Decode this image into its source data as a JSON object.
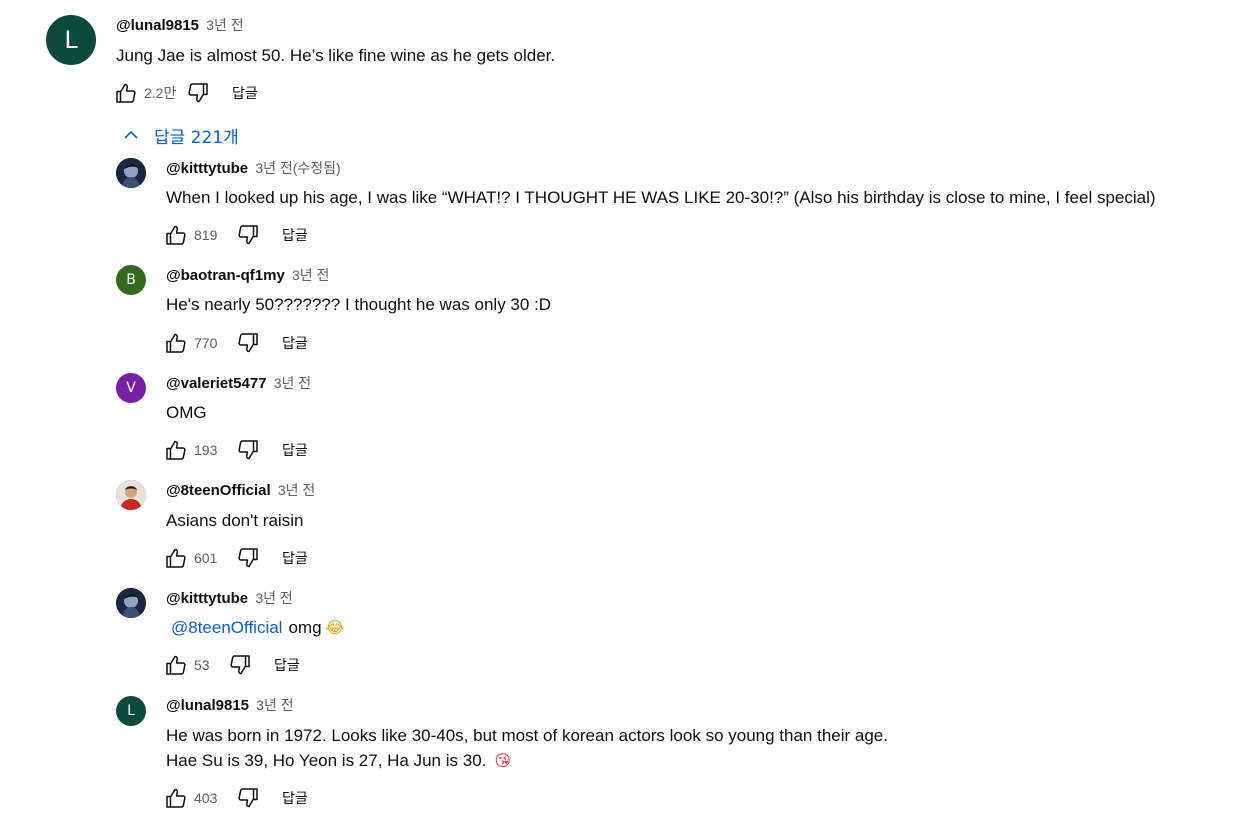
{
  "top_comment": {
    "avatar_letter": "L",
    "avatar_color": "#0d4a3e",
    "handle": "@lunal9815",
    "time": "3년 전",
    "text": "Jung Jae is almost 50. He’s like fine wine as he gets older.",
    "likes": "2.2만",
    "reply_label": "답글",
    "like_icon": "thumbs-up-icon",
    "dislike_icon": "thumbs-down-icon"
  },
  "replies_toggle": {
    "label": "답글 221개",
    "icon": "chevron-up-icon"
  },
  "replies": [
    {
      "handle": "@kitttytube",
      "time": "3년 전(수정됨)",
      "text": "When I looked up his age, I was like “WHAT!? I THOUGHT HE WAS LIKE 20-30!?” (Also his birthday is close to mine, I feel special)",
      "likes": "819",
      "reply_label": "답글",
      "avatar_type": "photo-dark"
    },
    {
      "handle": "@baotran-qf1my",
      "time": "3년 전",
      "text": "He's nearly 50??????? I thought he was only 30 :D",
      "likes": "770",
      "reply_label": "답글",
      "avatar_letter": "B",
      "avatar_color": "#33691e"
    },
    {
      "handle": "@valeriet5477",
      "time": "3년 전",
      "text": "OMG",
      "likes": "193",
      "reply_label": "답글",
      "avatar_letter": "V",
      "avatar_color": "#7b1fa2"
    },
    {
      "handle": "@8teenOfficial",
      "time": "3년 전",
      "text": "Asians don't raisin",
      "likes": "601",
      "reply_label": "답글",
      "avatar_type": "photo-red"
    },
    {
      "handle": "@kitttytube",
      "time": "3년 전",
      "mention": "@8teenOfficial",
      "text": "omg",
      "emoji": "😂",
      "likes": "53",
      "reply_label": "답글",
      "avatar_type": "photo-dark"
    },
    {
      "handle": "@lunal9815",
      "time": "3년 전",
      "text": "He was born in 1972. Looks like 30-40s, but most of korean actors look so young than their age.",
      "text2": "Hae Su is 39, Ho Yeon is 27, Ha Jun is 30.",
      "emoji": "😘",
      "likes": "403",
      "reply_label": "답글",
      "avatar_letter": "L",
      "avatar_color": "#0d4a3e"
    }
  ]
}
